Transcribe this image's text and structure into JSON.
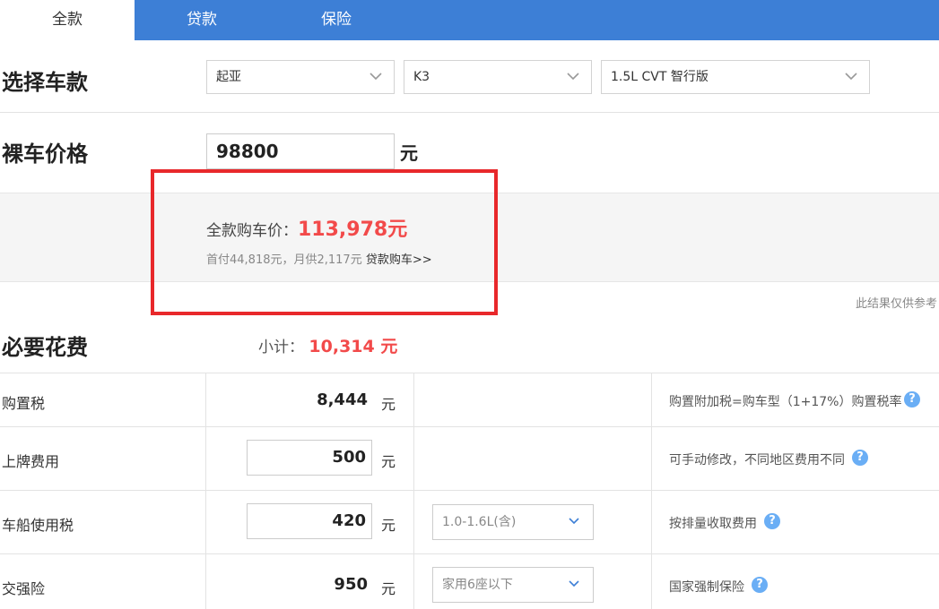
{
  "tabs": [
    {
      "label": "全款"
    },
    {
      "label": "贷款"
    },
    {
      "label": "保险"
    }
  ],
  "car_select": {
    "title": "选择车款",
    "brand": "起亚",
    "model": "K3",
    "version": "1.5L CVT 智行版"
  },
  "price": {
    "title": "裸车价格",
    "value": "98800",
    "unit": "元"
  },
  "summary": {
    "label": "全款购车价：",
    "total": "113,978元",
    "sub": "首付44,818元，月供2,117元",
    "loan_link": "贷款购车>>"
  },
  "disclaimer": "此结果仅供参考",
  "required": {
    "title": "必要花费",
    "subtotal_label": "小计：",
    "subtotal_value": "10,314 元",
    "rows": [
      {
        "label": "购置税",
        "value": "8,444",
        "unit": "元",
        "note": "购置附加税=购车型（1+17%）购置税率"
      },
      {
        "label": "上牌费用",
        "value": "500",
        "unit": "元",
        "note": "可手动修改，不同地区费用不同"
      },
      {
        "label": "车船使用税",
        "value": "420",
        "unit": "元",
        "option": "1.0-1.6L(含)",
        "note": "按排量收取费用"
      },
      {
        "label": "交强险",
        "value": "950",
        "unit": "元",
        "option": "家用6座以下",
        "note": "国家强制保险"
      }
    ]
  },
  "colors": {
    "tab_bg": "#3d7fd6",
    "accent_red": "#f24a4a",
    "highlight_box": "#e8282b",
    "help_icon": "#6aaef5"
  }
}
